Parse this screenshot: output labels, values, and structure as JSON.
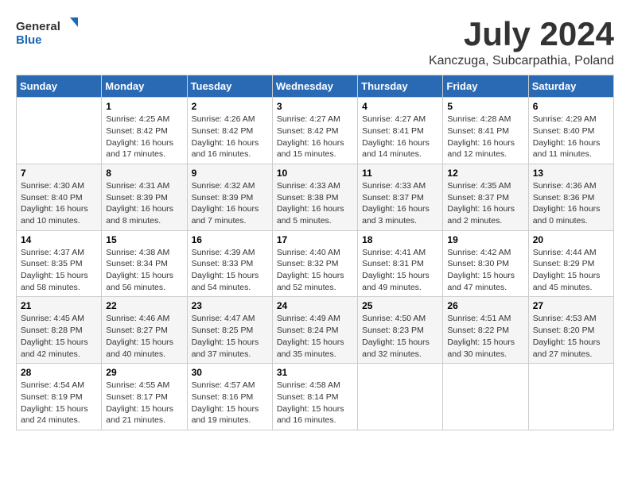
{
  "header": {
    "logo_general": "General",
    "logo_blue": "Blue",
    "month_title": "July 2024",
    "location": "Kanczuga, Subcarpathia, Poland"
  },
  "calendar": {
    "days_of_week": [
      "Sunday",
      "Monday",
      "Tuesday",
      "Wednesday",
      "Thursday",
      "Friday",
      "Saturday"
    ],
    "weeks": [
      [
        {
          "day": "",
          "info": ""
        },
        {
          "day": "1",
          "info": "Sunrise: 4:25 AM\nSunset: 8:42 PM\nDaylight: 16 hours\nand 17 minutes."
        },
        {
          "day": "2",
          "info": "Sunrise: 4:26 AM\nSunset: 8:42 PM\nDaylight: 16 hours\nand 16 minutes."
        },
        {
          "day": "3",
          "info": "Sunrise: 4:27 AM\nSunset: 8:42 PM\nDaylight: 16 hours\nand 15 minutes."
        },
        {
          "day": "4",
          "info": "Sunrise: 4:27 AM\nSunset: 8:41 PM\nDaylight: 16 hours\nand 14 minutes."
        },
        {
          "day": "5",
          "info": "Sunrise: 4:28 AM\nSunset: 8:41 PM\nDaylight: 16 hours\nand 12 minutes."
        },
        {
          "day": "6",
          "info": "Sunrise: 4:29 AM\nSunset: 8:40 PM\nDaylight: 16 hours\nand 11 minutes."
        }
      ],
      [
        {
          "day": "7",
          "info": "Sunrise: 4:30 AM\nSunset: 8:40 PM\nDaylight: 16 hours\nand 10 minutes."
        },
        {
          "day": "8",
          "info": "Sunrise: 4:31 AM\nSunset: 8:39 PM\nDaylight: 16 hours\nand 8 minutes."
        },
        {
          "day": "9",
          "info": "Sunrise: 4:32 AM\nSunset: 8:39 PM\nDaylight: 16 hours\nand 7 minutes."
        },
        {
          "day": "10",
          "info": "Sunrise: 4:33 AM\nSunset: 8:38 PM\nDaylight: 16 hours\nand 5 minutes."
        },
        {
          "day": "11",
          "info": "Sunrise: 4:33 AM\nSunset: 8:37 PM\nDaylight: 16 hours\nand 3 minutes."
        },
        {
          "day": "12",
          "info": "Sunrise: 4:35 AM\nSunset: 8:37 PM\nDaylight: 16 hours\nand 2 minutes."
        },
        {
          "day": "13",
          "info": "Sunrise: 4:36 AM\nSunset: 8:36 PM\nDaylight: 16 hours\nand 0 minutes."
        }
      ],
      [
        {
          "day": "14",
          "info": "Sunrise: 4:37 AM\nSunset: 8:35 PM\nDaylight: 15 hours\nand 58 minutes."
        },
        {
          "day": "15",
          "info": "Sunrise: 4:38 AM\nSunset: 8:34 PM\nDaylight: 15 hours\nand 56 minutes."
        },
        {
          "day": "16",
          "info": "Sunrise: 4:39 AM\nSunset: 8:33 PM\nDaylight: 15 hours\nand 54 minutes."
        },
        {
          "day": "17",
          "info": "Sunrise: 4:40 AM\nSunset: 8:32 PM\nDaylight: 15 hours\nand 52 minutes."
        },
        {
          "day": "18",
          "info": "Sunrise: 4:41 AM\nSunset: 8:31 PM\nDaylight: 15 hours\nand 49 minutes."
        },
        {
          "day": "19",
          "info": "Sunrise: 4:42 AM\nSunset: 8:30 PM\nDaylight: 15 hours\nand 47 minutes."
        },
        {
          "day": "20",
          "info": "Sunrise: 4:44 AM\nSunset: 8:29 PM\nDaylight: 15 hours\nand 45 minutes."
        }
      ],
      [
        {
          "day": "21",
          "info": "Sunrise: 4:45 AM\nSunset: 8:28 PM\nDaylight: 15 hours\nand 42 minutes."
        },
        {
          "day": "22",
          "info": "Sunrise: 4:46 AM\nSunset: 8:27 PM\nDaylight: 15 hours\nand 40 minutes."
        },
        {
          "day": "23",
          "info": "Sunrise: 4:47 AM\nSunset: 8:25 PM\nDaylight: 15 hours\nand 37 minutes."
        },
        {
          "day": "24",
          "info": "Sunrise: 4:49 AM\nSunset: 8:24 PM\nDaylight: 15 hours\nand 35 minutes."
        },
        {
          "day": "25",
          "info": "Sunrise: 4:50 AM\nSunset: 8:23 PM\nDaylight: 15 hours\nand 32 minutes."
        },
        {
          "day": "26",
          "info": "Sunrise: 4:51 AM\nSunset: 8:22 PM\nDaylight: 15 hours\nand 30 minutes."
        },
        {
          "day": "27",
          "info": "Sunrise: 4:53 AM\nSunset: 8:20 PM\nDaylight: 15 hours\nand 27 minutes."
        }
      ],
      [
        {
          "day": "28",
          "info": "Sunrise: 4:54 AM\nSunset: 8:19 PM\nDaylight: 15 hours\nand 24 minutes."
        },
        {
          "day": "29",
          "info": "Sunrise: 4:55 AM\nSunset: 8:17 PM\nDaylight: 15 hours\nand 21 minutes."
        },
        {
          "day": "30",
          "info": "Sunrise: 4:57 AM\nSunset: 8:16 PM\nDaylight: 15 hours\nand 19 minutes."
        },
        {
          "day": "31",
          "info": "Sunrise: 4:58 AM\nSunset: 8:14 PM\nDaylight: 15 hours\nand 16 minutes."
        },
        {
          "day": "",
          "info": ""
        },
        {
          "day": "",
          "info": ""
        },
        {
          "day": "",
          "info": ""
        }
      ]
    ]
  }
}
